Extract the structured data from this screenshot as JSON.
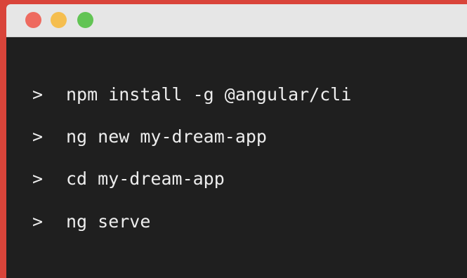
{
  "window": {
    "traffic_lights": {
      "close_color": "#ee6a5f",
      "minimize_color": "#f5be4f",
      "zoom_color": "#62c454"
    }
  },
  "terminal": {
    "prompt_symbol": ">",
    "background_color": "#1f1f1f",
    "text_color": "#ededed",
    "lines": [
      {
        "command": "npm install -g @angular/cli"
      },
      {
        "command": "ng new my-dream-app"
      },
      {
        "command": "cd my-dream-app"
      },
      {
        "command": "ng serve"
      }
    ]
  }
}
